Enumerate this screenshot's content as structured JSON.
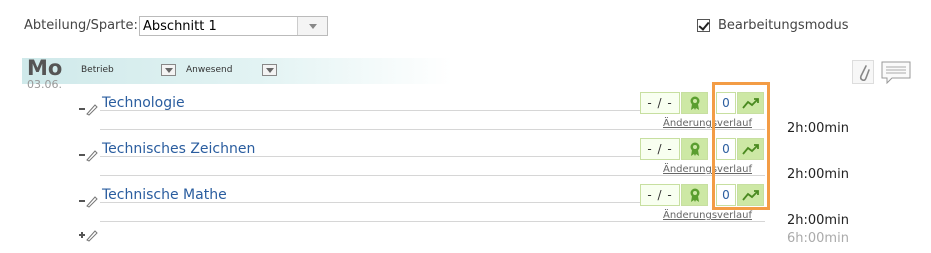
{
  "toolbar": {
    "department_label": "Abteilung/Sparte:",
    "department_value": "Abschnitt 1",
    "edit_mode_label": "Bearbeitungsmodus",
    "edit_mode_checked": true
  },
  "day": {
    "name": "Mo",
    "date": "03.06.",
    "column_1_label": "Betrieb",
    "column_2_label": "Anwesend"
  },
  "rows": [
    {
      "subject": "Technologie",
      "grade": "- / -",
      "count": "0",
      "history": "Änderungsverlauf",
      "duration": "2h:00min"
    },
    {
      "subject": "Technisches Zeichnen",
      "grade": "- / -",
      "count": "0",
      "history": "Änderungsverlauf",
      "duration": "2h:00min"
    },
    {
      "subject": "Technische Mathe",
      "grade": "- / -",
      "count": "0",
      "history": "Änderungsverlauf",
      "duration": "2h:00min"
    }
  ],
  "total_duration": "6h:00min",
  "colors": {
    "accent_green": "#cde8a5",
    "link_blue": "#2a5d9f",
    "highlight_orange": "#f39c45",
    "band_teal": "#cfe9ea"
  }
}
